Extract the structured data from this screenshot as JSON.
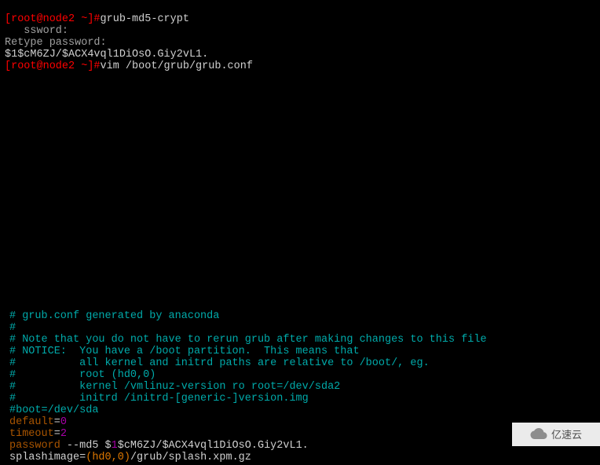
{
  "shell": {
    "prompt": "[root@node2 ~]#",
    "cmd1": "grub-md5-crypt",
    "sswordLine": "   ssword:",
    "retype": "Retype password:",
    "hash": "$1$cM6ZJ/$ACX4vql1DiOsO.Giy2vL1.",
    "cmd2": "vim /boot/grub/grub.conf"
  },
  "grub": {
    "c1": "# grub.conf generated by anaconda",
    "c2": "#",
    "c3": "# Note that you do not have to rerun grub after making changes to this file",
    "c4": "# NOTICE:  You have a /boot partition.  This means that",
    "c5": "#          all kernel and initrd paths are relative to /boot/, eg.",
    "c6": "#          root (hd0,0)",
    "c7": "#          kernel /vmlinuz-version ro root=/dev/sda2",
    "c8": "#          initrd /initrd-[generic-]version.img",
    "c9": "#boot=/dev/sda",
    "defaultKey": "default",
    "eq": "=",
    "defaultVal": "0",
    "timeoutKey": "timeout",
    "timeoutVal": "2",
    "passwordKey": "password",
    "passwordFlag": " --md5 $",
    "passwordOne": "1",
    "passwordRest": "$cM6ZJ/$ACX4vql1DiOsO.Giy2vL1.",
    "splashKey": "splashimage",
    "splashHd": "(hd0,0)",
    "splashPath": "/grub/splash.xpm.gz"
  },
  "watermark": {
    "text": "亿速云"
  }
}
